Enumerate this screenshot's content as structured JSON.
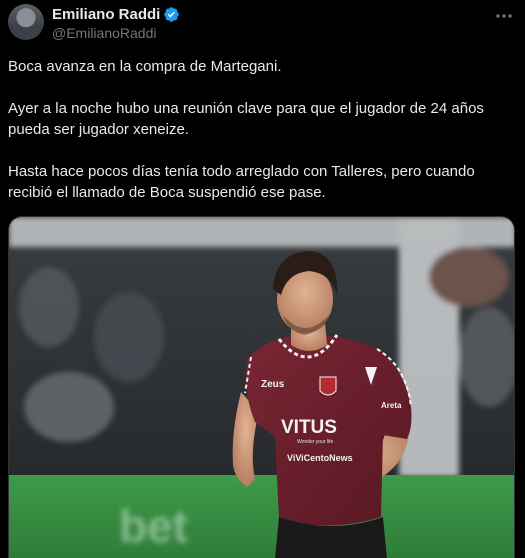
{
  "author": {
    "display_name": "Emiliano Raddi",
    "handle": "@EmilianoRaddi",
    "verified": true,
    "avatar_icon": "avatar-photo"
  },
  "menu_icon": "more-horizontal-icon",
  "tweet": {
    "paragraphs": [
      "Boca avanza en la compra de Martegani.",
      "Ayer a la noche hubo una reunión clave para que el jugador de 24 años pueda ser jugador xeneize.",
      "Hasta hace pocos días tenía todo arreglado con Talleres, pero cuando recibió el llamado de Boca suspendió ese pase."
    ]
  },
  "media": {
    "jersey_texts": {
      "sponsor_left": "Zeus",
      "sponsor_main": "VITUS",
      "sponsor_sub": "Wonder your life",
      "sponsor_bottom": "ViViCentoNews",
      "sleeve": "Areta"
    }
  },
  "colors": {
    "background": "#000000",
    "text": "#e7e9ea",
    "secondary_text": "#71767b",
    "verified_blue": "#1d9bf0",
    "jersey": "#6b1f2a"
  }
}
